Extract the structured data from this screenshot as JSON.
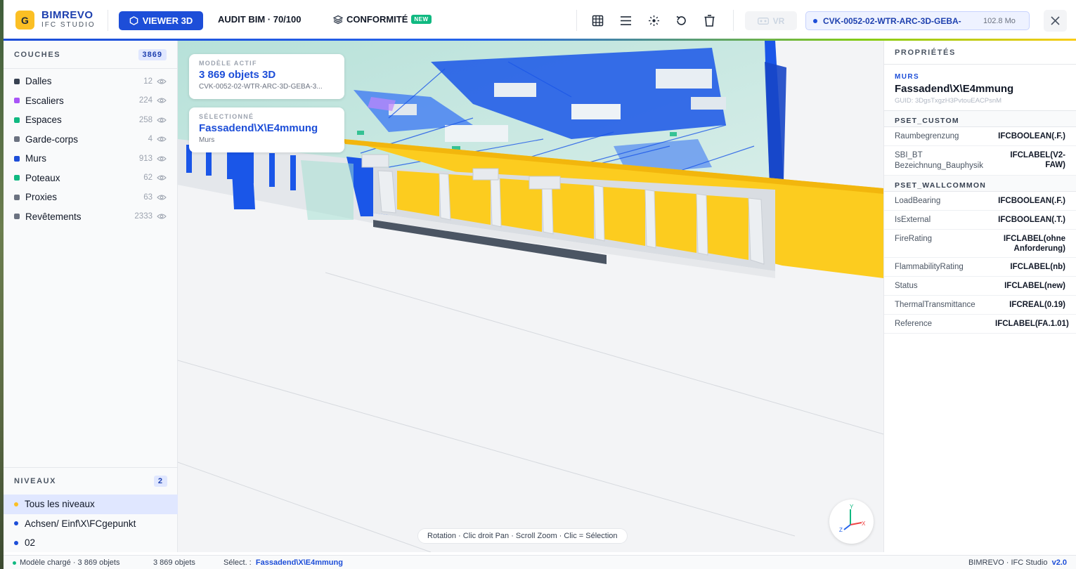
{
  "header": {
    "logo_letter": "G",
    "brand_name": "BIMREVO",
    "brand_sub": "IFC STUDIO",
    "viewer_label": "VIEWER 3D",
    "audit_label": "AUDIT BIM · 70/100",
    "conformite_label": "CONFORMITÉ",
    "new_badge": "NEW",
    "vr_label": "VR",
    "file_name": "CVK-0052-02-WTR-ARC-3D-GEBA-",
    "file_size": "102.8 Mo",
    "tool_icons": [
      "grid-icon",
      "list-icon",
      "explode-icon",
      "reset-icon",
      "trash-icon"
    ]
  },
  "layers": {
    "title": "COUCHES",
    "count": "3869",
    "items": [
      {
        "name": "Dalles",
        "count": "12",
        "color": "#374151"
      },
      {
        "name": "Escaliers",
        "count": "224",
        "color": "#a855f7"
      },
      {
        "name": "Espaces",
        "count": "258",
        "color": "#10b981"
      },
      {
        "name": "Garde-corps",
        "count": "4",
        "color": "#6b7280"
      },
      {
        "name": "Murs",
        "count": "913",
        "color": "#1d4ed8"
      },
      {
        "name": "Poteaux",
        "count": "62",
        "color": "#10b981"
      },
      {
        "name": "Proxies",
        "count": "63",
        "color": "#6b7280"
      },
      {
        "name": "Revêtements",
        "count": "2333",
        "color": "#6b7280"
      }
    ]
  },
  "levels": {
    "title": "NIVEAUX",
    "count": "2",
    "items": [
      {
        "name": "Tous les niveaux",
        "color": "#fbbf24"
      },
      {
        "name": "Achsen/ Einf\\X\\FCgepunkt",
        "color": "#1d4ed8"
      },
      {
        "name": "02",
        "color": "#1d4ed8"
      }
    ]
  },
  "viewport": {
    "active_label": "MODÈLE ACTIF",
    "active_title": "3 869 objets 3D",
    "active_sub": "CVK-0052-02-WTR-ARC-3D-GEBA-3...",
    "selected_label": "SÉLECTIONNÉ",
    "selected_title": "Fassadend\\X\\E4mmung",
    "selected_sub": "Murs",
    "hint": "Rotation · Clic droit Pan · Scroll Zoom · Clic = Sélection",
    "axis": {
      "x": "X",
      "y": "Y",
      "z": "Z"
    }
  },
  "properties": {
    "title": "PROPRIÉTÉS",
    "category": "MURS",
    "name": "Fassadend\\X\\E4mmung",
    "guid": "GUID: 3DgsTxgzH3PvtouEACPsnM",
    "psets": [
      {
        "title": "PSET_CUSTOM",
        "rows": [
          {
            "key": "Raumbegrenzung",
            "value": "IFCBOOLEAN(.F.)"
          },
          {
            "key": "SBI_BT Bezeichnung_Bauphysik",
            "value": "IFCLABEL(V2-FAW)"
          }
        ]
      },
      {
        "title": "PSET_WALLCOMMON",
        "rows": [
          {
            "key": "LoadBearing",
            "value": "IFCBOOLEAN(.F.)"
          },
          {
            "key": "IsExternal",
            "value": "IFCBOOLEAN(.T.)"
          },
          {
            "key": "FireRating",
            "value": "IFCLABEL(ohne Anforderung)"
          },
          {
            "key": "FlammabilityRating",
            "value": "IFCLABEL(nb)"
          },
          {
            "key": "Status",
            "value": "IFCLABEL(new)"
          },
          {
            "key": "ThermalTransmittance",
            "value": "IFCREAL(0.19)"
          },
          {
            "key": "Reference",
            "value": "IFCLABEL(FA.1.01)"
          }
        ]
      }
    ]
  },
  "statusbar": {
    "loaded": "Modèle chargé · 3 869 objets",
    "objects": "3 869 objets",
    "select_label": "Sélect. :",
    "select_value": "Fassadend\\X\\E4mmung",
    "app": "BIMREVO · IFC Studio",
    "version": "v2.0"
  },
  "colors": {
    "accent": "#1d4ed8",
    "logo": "#fbbf24",
    "facade_yellow": "#fccc1f",
    "wall_blue": "#1a56e8"
  }
}
